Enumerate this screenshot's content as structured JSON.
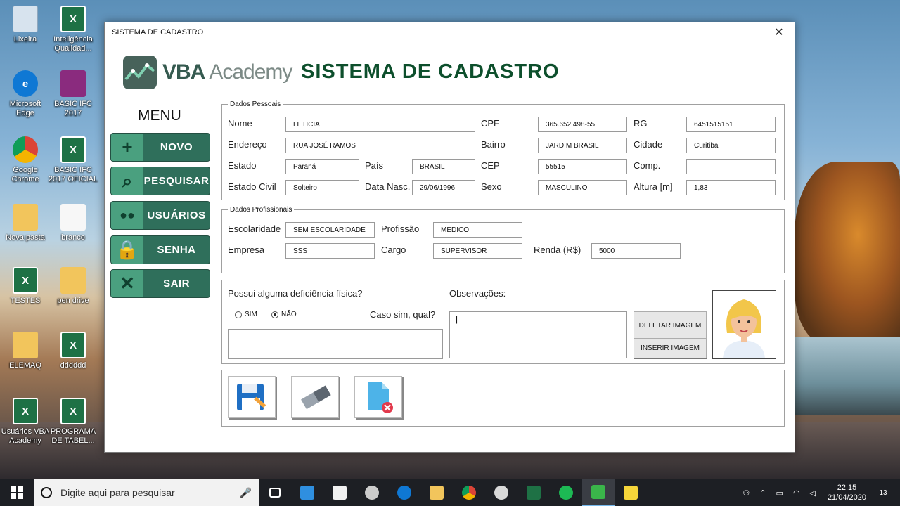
{
  "desktop": {
    "icons": [
      {
        "label": "Lixeira",
        "icon": "recycle-bin-icon"
      },
      {
        "label": "Inteligência Qualidad...",
        "icon": "excel-icon"
      },
      {
        "label": "Microsoft Edge",
        "icon": "edge-icon"
      },
      {
        "label": "BASIC IFC 2017",
        "icon": "winrar-icon"
      },
      {
        "label": "Google Chrome",
        "icon": "chrome-icon"
      },
      {
        "label": "BASIC IFC 2017 OFICIAL",
        "icon": "excel-icon"
      },
      {
        "label": "Nova pasta",
        "icon": "folder-icon"
      },
      {
        "label": "branco",
        "icon": "blank-file-icon"
      },
      {
        "label": "TESTES",
        "icon": "excel-icon"
      },
      {
        "label": "pen drive",
        "icon": "folder-icon"
      },
      {
        "label": "ELEMAQ",
        "icon": "folder-icon"
      },
      {
        "label": "dddddd",
        "icon": "excel-icon"
      },
      {
        "label": "Usuários VBA Academy",
        "icon": "excel-icon"
      },
      {
        "label": "PROGRAMA DE TABEL...",
        "icon": "excel-icon"
      }
    ]
  },
  "window": {
    "title": "SISTEMA DE CADASTRO",
    "close_glyph": "✕",
    "logo_vba": "VBA",
    "logo_academy": "Academy",
    "heading": "SISTEMA DE CADASTRO"
  },
  "menu": {
    "title": "MENU",
    "items": [
      {
        "label": "NOVO",
        "icon": "plus-icon"
      },
      {
        "label": "PESQUISAR",
        "icon": "magnifier-icon"
      },
      {
        "label": "USUÁRIOS",
        "icon": "users-icon"
      },
      {
        "label": "SENHA",
        "icon": "lock-icon"
      },
      {
        "label": "SAIR",
        "icon": "x-icon"
      }
    ]
  },
  "personal": {
    "legend": "Dados Pessoais",
    "labels": {
      "nome": "Nome",
      "cpf": "CPF",
      "rg": "RG",
      "endereco": "Endereço",
      "bairro": "Bairro",
      "cidade": "Cidade",
      "estado": "Estado",
      "pais": "País",
      "cep": "CEP",
      "comp": "Comp.",
      "estado_civil": "Estado Civil",
      "data_nasc": "Data Nasc.",
      "sexo": "Sexo",
      "altura": "Altura [m]"
    },
    "values": {
      "nome": "LETICIA",
      "cpf": "365.652.498-55",
      "rg": "6451515151",
      "endereco": "RUA JOSÉ RAMOS",
      "bairro": "JARDIM BRASIL",
      "cidade": "Curitiba",
      "estado": "Paraná",
      "pais": "BRASIL",
      "cep": "55515",
      "comp": "",
      "estado_civil": "Solteiro",
      "data_nasc": "29/06/1996",
      "sexo": "MASCULINO",
      "altura": "1,83"
    }
  },
  "professional": {
    "legend": "Dados Profissionais",
    "labels": {
      "escolaridade": "Escolaridade",
      "profissao": "Profissão",
      "empresa": "Empresa",
      "cargo": "Cargo",
      "renda": "Renda (R$)"
    },
    "values": {
      "escolaridade": "SEM ESCOLARIDADE",
      "profissao": "MÉDICO",
      "empresa": "SSS",
      "cargo": "SUPERVISOR",
      "renda": "5000"
    }
  },
  "extra": {
    "deficiency_question": "Possui alguma deficiência física?",
    "option_sim": "SIM",
    "option_nao": "NÃO",
    "selected": "NÃO",
    "which_label": "Caso sim, qual?",
    "which_value": "",
    "obs_label": "Observações:",
    "obs_value": "|",
    "delete_image": "DELETAR IMAGEM",
    "insert_image": "INSERIR IMAGEM"
  },
  "actions": [
    {
      "name": "save",
      "icon": "floppy-disk-icon"
    },
    {
      "name": "clear",
      "icon": "eraser-icon"
    },
    {
      "name": "delete",
      "icon": "delete-file-icon"
    }
  ],
  "taskbar": {
    "search_placeholder": "Digite aqui para pesquisar",
    "time": "22:15",
    "date": "21/04/2020",
    "notification_count": "13"
  }
}
